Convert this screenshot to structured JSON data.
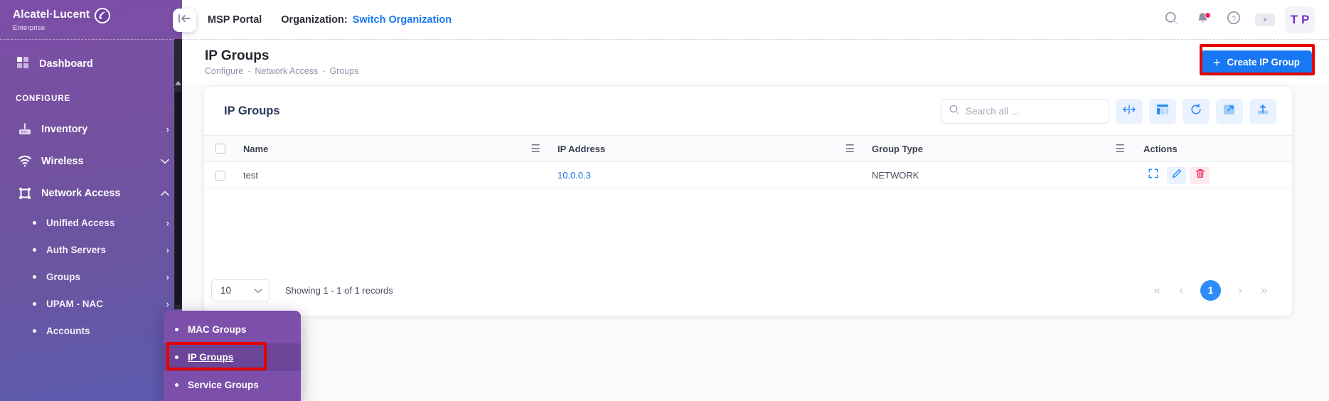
{
  "brand": {
    "name": "Alcatel·Lucent",
    "sub": "Enterprise",
    "logo_icon": "alcatel-lucent-logo-icon"
  },
  "sidebar": {
    "dashboard": {
      "label": "Dashboard",
      "icon": "grid-icon"
    },
    "section_label": "CONFIGURE",
    "items": [
      {
        "label": "Inventory",
        "icon": "router-icon",
        "chevron": "›"
      },
      {
        "label": "Wireless",
        "icon": "wifi-icon",
        "chevron": "⌄"
      },
      {
        "label": "Network Access",
        "icon": "network-access-icon",
        "chevron": "⌃"
      }
    ],
    "subitems": [
      {
        "label": "Unified Access",
        "chevron": "›"
      },
      {
        "label": "Auth Servers",
        "chevron": "›"
      },
      {
        "label": "Groups",
        "chevron": "›"
      },
      {
        "label": "UPAM - NAC",
        "chevron": "›"
      },
      {
        "label": "Accounts",
        "chevron": "›"
      }
    ],
    "collapse_icon": "collapse-sidebar-icon"
  },
  "flyout": {
    "items": [
      {
        "label": "MAC Groups",
        "active": false
      },
      {
        "label": "IP Groups",
        "active": true
      },
      {
        "label": "Service Groups",
        "active": false
      }
    ]
  },
  "topbar": {
    "msp_portal": "MSP Portal",
    "organization_label": "Organization:",
    "organization_link": "Switch Organization",
    "icons": [
      "search-icon",
      "notifications-bell-icon",
      "help-circle-icon",
      "video-play-icon"
    ],
    "avatar_initials": [
      "T",
      "P"
    ]
  },
  "page": {
    "title": "IP Groups",
    "breadcrumb": [
      "Configure",
      "Network Access",
      "Groups"
    ],
    "breadcrumb_sep": "-",
    "create_button": "Create IP Group",
    "create_plus": "+"
  },
  "card": {
    "title": "IP Groups",
    "search_placeholder": "Search all ...",
    "search_value": "",
    "tools": [
      "fit-columns-icon",
      "column-settings-icon",
      "refresh-icon",
      "fullscreen-icon",
      "export-icon"
    ]
  },
  "table": {
    "columns": [
      "Name",
      "IP Address",
      "Group Type",
      "Actions"
    ],
    "rows": [
      {
        "name": "test",
        "ip_address": "10.0.0.3",
        "group_type": "NETWORK"
      }
    ],
    "row_actions": [
      "expand-icon",
      "edit-pencil-icon",
      "delete-trash-icon"
    ]
  },
  "footer": {
    "page_size": "10",
    "records_text": "Showing 1 - 1 of 1 records",
    "pager": {
      "first": "«",
      "prev": "‹",
      "current": "1",
      "next": "›",
      "last": "»"
    }
  },
  "colors": {
    "sidebar_top": "#7d4ea8",
    "sidebar_bottom": "#5c5bb0",
    "accent_blue": "#1877f2",
    "highlight_red": "#e60000",
    "flyout_active": "#6b4598",
    "avatar_purple": "#7f2bd6",
    "delete_red": "#f5225c"
  }
}
